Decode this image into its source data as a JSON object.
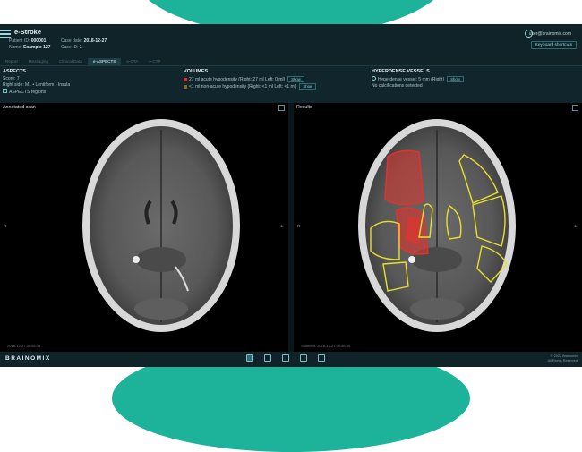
{
  "app": {
    "title": "e-Stroke"
  },
  "patient": {
    "id_label": "Patient ID:",
    "id": "000001",
    "name_label": "Name:",
    "name": "Example 127",
    "date_label": "Case date:",
    "date": "2018-12-27",
    "case_label": "Case ID:",
    "case_id": "1"
  },
  "user": {
    "email": "user@brainomix.com"
  },
  "buttons": {
    "keyboard": "Keyboard shortcuts",
    "show": "Show"
  },
  "tabs": [
    {
      "label": "Report"
    },
    {
      "label": "Messaging"
    },
    {
      "label": "Clinical Data"
    },
    {
      "label": "e-ASPECTS"
    },
    {
      "label": "e-CTA"
    },
    {
      "label": "e-CTP"
    }
  ],
  "aspects": {
    "heading": "ASPECTS",
    "score_line": "Score: 7",
    "regions_line": "Right side:   M1  •  Lentiform  •  Insula",
    "regions_toggle": "ASPECTS regions"
  },
  "volumes": {
    "heading": "VOLUMES",
    "acute_line": "27 ml acute hypodensity (Right: 27 ml  Left: 0 ml)",
    "nonacute_line": "<1 ml non-acute hypodensity (Right: <1 ml  Left: <1 ml)",
    "acute_color": "#e0342d",
    "nonacute_color": "#8a6a2c"
  },
  "vessels": {
    "heading": "HYPERDENSE VESSELS",
    "line1": "Hyperdense vessel: 5 mm (Right)",
    "line2": "No calcifications detected"
  },
  "panels": {
    "left_title": "Annotated scan",
    "right_title": "Results",
    "left_side": "R",
    "right_side": "L",
    "left_stamp": "2018-12-27 09:56:35",
    "right_stamp": "Scanned: 2018-12-27 09:56:35"
  },
  "footer": {
    "logo": "BRAINOMIX",
    "copyright_line1": "© 2022 Brainomix",
    "copyright_line2": "All Rights Reserved",
    "icons": [
      "info-icon",
      "scan-icon",
      "layers-icon",
      "settings-icon",
      "export-icon"
    ]
  },
  "colors": {
    "accent": "#1db39a",
    "region_outline": "#e8e02a",
    "lesion": "#e0342d"
  }
}
